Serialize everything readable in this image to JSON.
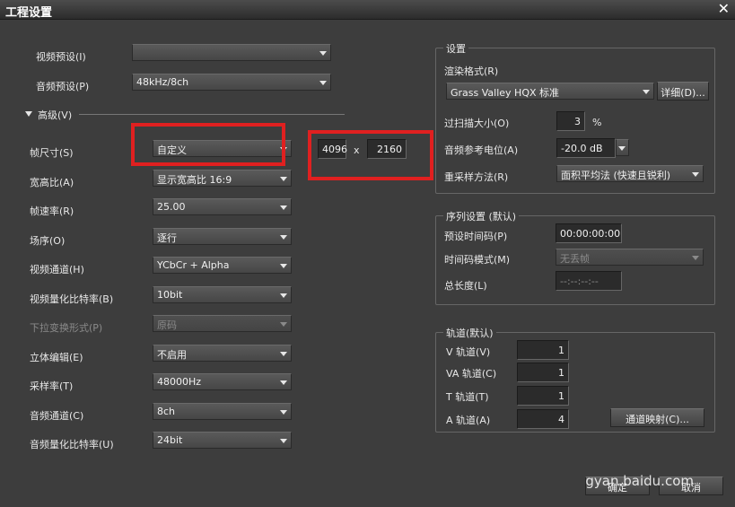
{
  "window": {
    "title": "工程设置",
    "close_glyph": "✕"
  },
  "left": {
    "video_preset": {
      "label": "视频预设(I)",
      "value": ""
    },
    "audio_preset": {
      "label": "音频预设(P)",
      "value": "48kHz/8ch"
    },
    "advanced": {
      "label": "高级(V)"
    },
    "frame_size": {
      "label": "帧尺寸(S)",
      "value": "自定义",
      "width": "4096",
      "separator": "x",
      "height": "2160"
    },
    "aspect_ratio": {
      "label": "宽高比(A)",
      "value": "显示宽高比 16:9"
    },
    "frame_rate": {
      "label": "帧速率(R)",
      "value": "25.00"
    },
    "field_order": {
      "label": "场序(O)",
      "value": "逐行"
    },
    "video_channel": {
      "label": "视频通道(H)",
      "value": "YCbCr + Alpha"
    },
    "video_bitdepth": {
      "label": "视频量化比特率(B)",
      "value": "10bit"
    },
    "pulldown": {
      "label": "下拉变换形式(P)",
      "value": "原码"
    },
    "stereo_edit": {
      "label": "立体编辑(E)",
      "value": "不启用"
    },
    "sample_rate": {
      "label": "采样率(T)",
      "value": "48000Hz"
    },
    "audio_channel": {
      "label": "音频通道(C)",
      "value": "8ch"
    },
    "audio_bitdepth": {
      "label": "音频量化比特率(U)",
      "value": "24bit"
    }
  },
  "settings_group": {
    "title": "设置",
    "render_format": {
      "label": "渲染格式(R)",
      "value": "Grass Valley HQX 标准",
      "detail_button": "详细(D)..."
    },
    "overscan": {
      "label": "过扫描大小(O)",
      "value": "3",
      "unit": "%"
    },
    "audio_ref_level": {
      "label": "音频参考电位(A)",
      "value": "-20.0 dB"
    },
    "resample": {
      "label": "重采样方法(R)",
      "value": "面积平均法 (快速且锐利)"
    }
  },
  "sequence_group": {
    "title": "序列设置 (默认)",
    "preset_timecode": {
      "label": "预设时间码(P)",
      "value": "00:00:00:00"
    },
    "timecode_mode": {
      "label": "时间码模式(M)",
      "value": "无丢帧"
    },
    "total_length": {
      "label": "总长度(L)",
      "value": "--:--:--:--"
    }
  },
  "tracks_group": {
    "title": "轨道(默认)",
    "v_track": {
      "label": "V 轨道(V)",
      "value": "1"
    },
    "va_track": {
      "label": "VA 轨道(C)",
      "value": "1"
    },
    "t_track": {
      "label": "T 轨道(T)",
      "value": "1"
    },
    "a_track": {
      "label": "A 轨道(A)",
      "value": "4"
    },
    "channel_map_button": "通道映射(C)..."
  },
  "footer": {
    "ok_button": "确定",
    "cancel_button": "取消"
  },
  "watermark": "gyan.baidu.com",
  "colors": {
    "annotation_red": "#e02020",
    "background": "#3d3d3d"
  }
}
